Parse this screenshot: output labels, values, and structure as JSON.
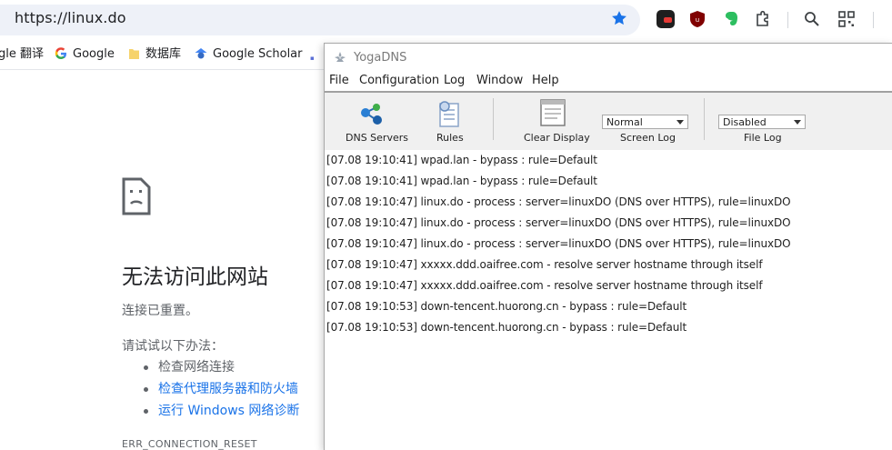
{
  "browser": {
    "url": "https://linux.do",
    "bookmarks": [
      {
        "label": "gle 翻译"
      },
      {
        "label": "Google"
      },
      {
        "label": "数据库"
      },
      {
        "label": "Google Scholar"
      }
    ]
  },
  "error_page": {
    "title": "无法访问此网站",
    "subtitle": "连接已重置。",
    "try_heading": "请试试以下办法：",
    "suggestions": [
      "检查网络连接",
      "检查代理服务器和防火墙",
      "运行 Windows 网络诊断"
    ],
    "code": "ERR_CONNECTION_RESET"
  },
  "app": {
    "title": "YogaDNS",
    "menu": [
      "File",
      "Configuration",
      "Log",
      "Window",
      "Help"
    ],
    "toolbar": {
      "dns_servers": "DNS Servers",
      "rules": "Rules",
      "clear_display": "Clear Display",
      "screen_log_label": "Screen Log",
      "screen_log_value": "Normal",
      "file_log_label": "File Log",
      "file_log_value": "Disabled"
    },
    "log": [
      "[07.08 19:10:41] wpad.lan - bypass : rule=Default",
      "[07.08 19:10:41] wpad.lan - bypass : rule=Default",
      "[07.08 19:10:47] linux.do - process : server=linuxDO (DNS over HTTPS), rule=linuxDO",
      "[07.08 19:10:47] linux.do - process : server=linuxDO (DNS over HTTPS), rule=linuxDO",
      "[07.08 19:10:47] linux.do - process : server=linuxDO (DNS over HTTPS), rule=linuxDO",
      "[07.08 19:10:47] xxxxx.ddd.oaifree.com - resolve server hostname through itself",
      "[07.08 19:10:47] xxxxx.ddd.oaifree.com - resolve server hostname through itself",
      "[07.08 19:10:53] down-tencent.huorong.cn - bypass : rule=Default",
      "[07.08 19:10:53] down-tencent.huorong.cn - bypass : rule=Default"
    ]
  },
  "colors": {
    "accent": "#1a73e8",
    "toolbar_bg": "#f0f0f0",
    "omnibox_bg": "#eef1f8"
  }
}
